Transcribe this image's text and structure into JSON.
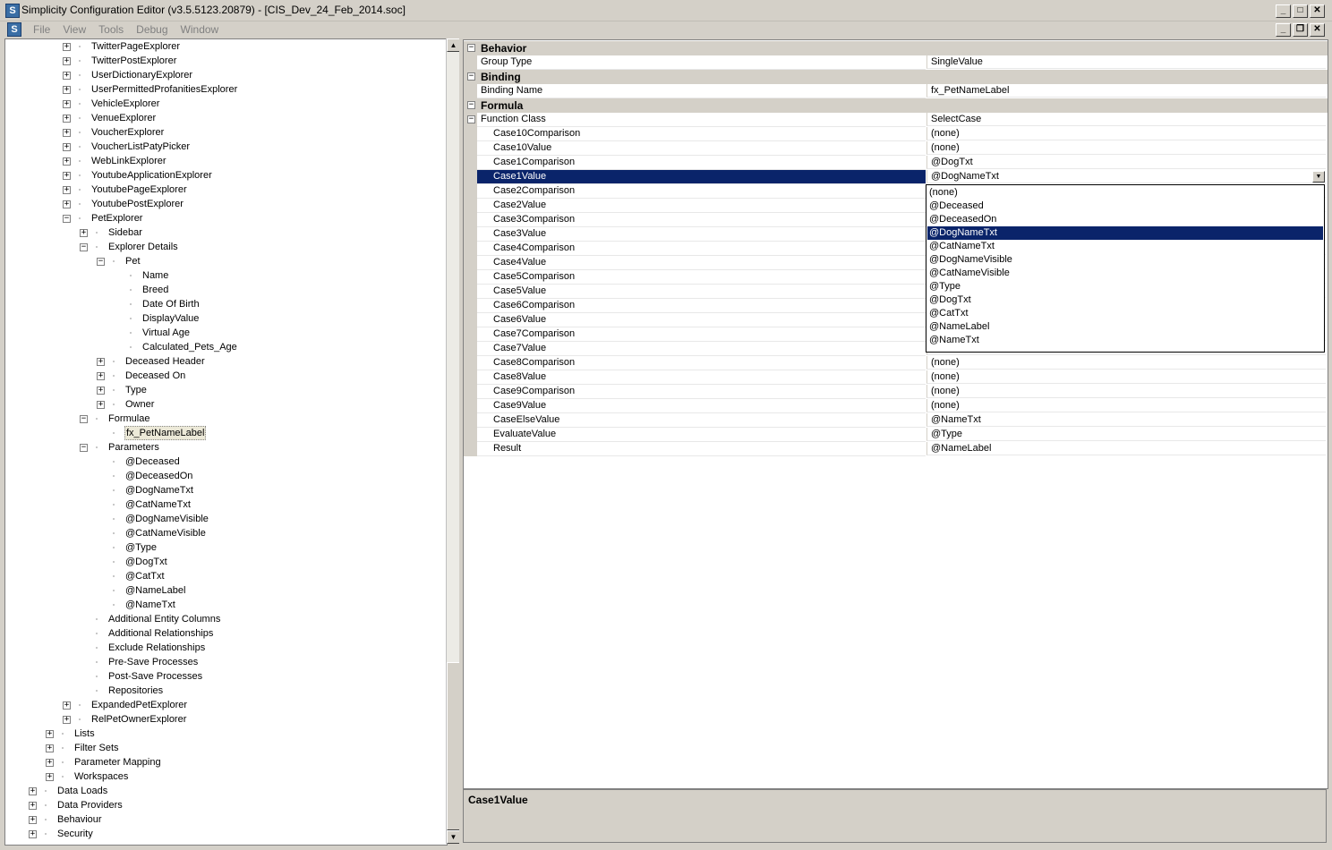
{
  "window": {
    "title": "Simplicity Configuration Editor (v3.5.5123.20879) - [CIS_Dev_24_Feb_2014.soc]",
    "app_icon_letter": "S",
    "controls": [
      "_",
      "□",
      "✕"
    ],
    "mdi_controls": [
      "_",
      "❐",
      "✕"
    ]
  },
  "menu": {
    "items": [
      "File",
      "View",
      "Tools",
      "Debug",
      "Window"
    ]
  },
  "tree": {
    "items": [
      {
        "label": "TwitterPageExplorer",
        "level": 2,
        "exp": "+"
      },
      {
        "label": "TwitterPostExplorer",
        "level": 2,
        "exp": "+"
      },
      {
        "label": "UserDictionaryExplorer",
        "level": 2,
        "exp": "+"
      },
      {
        "label": "UserPermittedProfanitiesExplorer",
        "level": 2,
        "exp": "+"
      },
      {
        "label": "VehicleExplorer",
        "level": 2,
        "exp": "+"
      },
      {
        "label": "VenueExplorer",
        "level": 2,
        "exp": "+"
      },
      {
        "label": "VoucherExplorer",
        "level": 2,
        "exp": "+"
      },
      {
        "label": "VoucherListPatyPicker",
        "level": 2,
        "exp": "+"
      },
      {
        "label": "WebLinkExplorer",
        "level": 2,
        "exp": "+"
      },
      {
        "label": "YoutubeApplicationExplorer",
        "level": 2,
        "exp": "+"
      },
      {
        "label": "YoutubePageExplorer",
        "level": 2,
        "exp": "+"
      },
      {
        "label": "YoutubePostExplorer",
        "level": 2,
        "exp": "+"
      },
      {
        "label": "PetExplorer",
        "level": 2,
        "exp": "-"
      },
      {
        "label": "Sidebar",
        "level": 3,
        "exp": "+"
      },
      {
        "label": "Explorer Details",
        "level": 3,
        "exp": "-"
      },
      {
        "label": "Pet",
        "level": 4,
        "exp": "-"
      },
      {
        "label": "Name",
        "level": 5,
        "exp": ""
      },
      {
        "label": "Breed",
        "level": 5,
        "exp": ""
      },
      {
        "label": "Date Of Birth",
        "level": 5,
        "exp": ""
      },
      {
        "label": "DisplayValue",
        "level": 5,
        "exp": ""
      },
      {
        "label": "Virtual Age",
        "level": 5,
        "exp": ""
      },
      {
        "label": "Calculated_Pets_Age",
        "level": 5,
        "exp": ""
      },
      {
        "label": "Deceased Header",
        "level": 4,
        "exp": "+"
      },
      {
        "label": "Deceased On",
        "level": 4,
        "exp": "+"
      },
      {
        "label": "Type",
        "level": 4,
        "exp": "+"
      },
      {
        "label": "Owner",
        "level": 4,
        "exp": "+"
      },
      {
        "label": "Formulae",
        "level": 3,
        "exp": "-"
      },
      {
        "label": "fx_PetNameLabel",
        "level": 4,
        "exp": "",
        "selected": true
      },
      {
        "label": "Parameters",
        "level": 3,
        "exp": "-"
      },
      {
        "label": "@Deceased",
        "level": 4,
        "exp": ""
      },
      {
        "label": "@DeceasedOn",
        "level": 4,
        "exp": ""
      },
      {
        "label": "@DogNameTxt",
        "level": 4,
        "exp": ""
      },
      {
        "label": "@CatNameTxt",
        "level": 4,
        "exp": ""
      },
      {
        "label": "@DogNameVisible",
        "level": 4,
        "exp": ""
      },
      {
        "label": "@CatNameVisible",
        "level": 4,
        "exp": ""
      },
      {
        "label": "@Type",
        "level": 4,
        "exp": ""
      },
      {
        "label": "@DogTxt",
        "level": 4,
        "exp": ""
      },
      {
        "label": "@CatTxt",
        "level": 4,
        "exp": ""
      },
      {
        "label": "@NameLabel",
        "level": 4,
        "exp": ""
      },
      {
        "label": "@NameTxt",
        "level": 4,
        "exp": ""
      },
      {
        "label": "Additional Entity Columns",
        "level": 3,
        "exp": ""
      },
      {
        "label": "Additional Relationships",
        "level": 3,
        "exp": ""
      },
      {
        "label": "Exclude Relationships",
        "level": 3,
        "exp": ""
      },
      {
        "label": "Pre-Save Processes",
        "level": 3,
        "exp": ""
      },
      {
        "label": "Post-Save Processes",
        "level": 3,
        "exp": ""
      },
      {
        "label": "Repositories",
        "level": 3,
        "exp": ""
      },
      {
        "label": "ExpandedPetExplorer",
        "level": 2,
        "exp": "+"
      },
      {
        "label": "RelPetOwnerExplorer",
        "level": 2,
        "exp": "+"
      },
      {
        "label": "Lists",
        "level": 1,
        "exp": "+"
      },
      {
        "label": "Filter Sets",
        "level": 1,
        "exp": "+"
      },
      {
        "label": "Parameter Mapping",
        "level": 1,
        "exp": "+"
      },
      {
        "label": "Workspaces",
        "level": 1,
        "exp": "+"
      },
      {
        "label": "Data Loads",
        "level": 0,
        "exp": "+"
      },
      {
        "label": "Data Providers",
        "level": 0,
        "exp": "+"
      },
      {
        "label": "Behaviour",
        "level": 0,
        "exp": "+"
      },
      {
        "label": "Security",
        "level": 0,
        "exp": "+"
      }
    ]
  },
  "grid": {
    "rows": [
      {
        "kind": "cat",
        "name": "Behavior"
      },
      {
        "kind": "prop",
        "name": "Group Type",
        "value": "SingleValue",
        "indent": 0
      },
      {
        "kind": "cat",
        "name": "Binding"
      },
      {
        "kind": "prop",
        "name": "Binding Name",
        "value": "fx_PetNameLabel",
        "indent": 0
      },
      {
        "kind": "cat",
        "name": "Formula"
      },
      {
        "kind": "prop",
        "name": "Function Class",
        "value": "SelectCase",
        "indent": 0,
        "exp": "-"
      },
      {
        "kind": "prop",
        "name": "Case10Comparison",
        "value": "(none)",
        "indent": 1
      },
      {
        "kind": "prop",
        "name": "Case10Value",
        "value": "(none)",
        "indent": 1
      },
      {
        "kind": "prop",
        "name": "Case1Comparison",
        "value": "@DogTxt",
        "indent": 1
      },
      {
        "kind": "prop",
        "name": "Case1Value",
        "value": "@DogNameTxt",
        "indent": 1,
        "selected": true
      },
      {
        "kind": "prop",
        "name": "Case2Comparison",
        "value": "",
        "indent": 1
      },
      {
        "kind": "prop",
        "name": "Case2Value",
        "value": "",
        "indent": 1
      },
      {
        "kind": "prop",
        "name": "Case3Comparison",
        "value": "",
        "indent": 1
      },
      {
        "kind": "prop",
        "name": "Case3Value",
        "value": "",
        "indent": 1
      },
      {
        "kind": "prop",
        "name": "Case4Comparison",
        "value": "",
        "indent": 1
      },
      {
        "kind": "prop",
        "name": "Case4Value",
        "value": "",
        "indent": 1
      },
      {
        "kind": "prop",
        "name": "Case5Comparison",
        "value": "",
        "indent": 1
      },
      {
        "kind": "prop",
        "name": "Case5Value",
        "value": "",
        "indent": 1
      },
      {
        "kind": "prop",
        "name": "Case6Comparison",
        "value": "",
        "indent": 1
      },
      {
        "kind": "prop",
        "name": "Case6Value",
        "value": "",
        "indent": 1
      },
      {
        "kind": "prop",
        "name": "Case7Comparison",
        "value": "",
        "indent": 1
      },
      {
        "kind": "prop",
        "name": "Case7Value",
        "value": "",
        "indent": 1
      },
      {
        "kind": "prop",
        "name": "Case8Comparison",
        "value": "(none)",
        "indent": 1
      },
      {
        "kind": "prop",
        "name": "Case8Value",
        "value": "(none)",
        "indent": 1
      },
      {
        "kind": "prop",
        "name": "Case9Comparison",
        "value": "(none)",
        "indent": 1
      },
      {
        "kind": "prop",
        "name": "Case9Value",
        "value": "(none)",
        "indent": 1
      },
      {
        "kind": "prop",
        "name": "CaseElseValue",
        "value": "@NameTxt",
        "indent": 1
      },
      {
        "kind": "prop",
        "name": "EvaluateValue",
        "value": "@Type",
        "indent": 1
      },
      {
        "kind": "prop",
        "name": "Result",
        "value": "@NameLabel",
        "indent": 1
      }
    ]
  },
  "dropdown": {
    "options": [
      "(none)",
      "@Deceased",
      "@DeceasedOn",
      "@DogNameTxt",
      "@CatNameTxt",
      "@DogNameVisible",
      "@CatNameVisible",
      "@Type",
      "@DogTxt",
      "@CatTxt",
      "@NameLabel",
      "@NameTxt"
    ],
    "highlighted": "@DogNameTxt"
  },
  "description": {
    "title": "Case1Value"
  }
}
